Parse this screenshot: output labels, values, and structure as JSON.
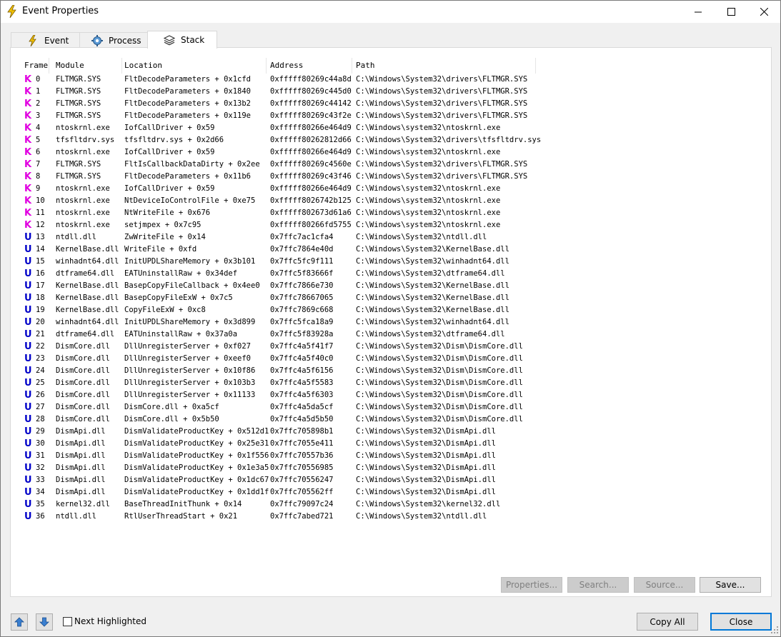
{
  "window": {
    "title": "Event Properties"
  },
  "tabs": [
    {
      "label": "Event",
      "icon": "lightning-icon",
      "active": false
    },
    {
      "label": "Process",
      "icon": "gear-icon",
      "active": false
    },
    {
      "label": "Stack",
      "icon": "layers-icon",
      "active": true
    }
  ],
  "columns": {
    "frame": "Frame",
    "module": "Module",
    "location": "Location",
    "address": "Address",
    "path": "Path"
  },
  "colors": {
    "kernel": "#e000e0",
    "user": "#0000c8",
    "accent": "#0078d7"
  },
  "frames": [
    {
      "type": "K",
      "frame": "0",
      "module": "FLTMGR.SYS",
      "location": "FltDecodeParameters + 0x1cfd",
      "address": "0xfffff80269c44a8d",
      "path": "C:\\Windows\\System32\\drivers\\FLTMGR.SYS"
    },
    {
      "type": "K",
      "frame": "1",
      "module": "FLTMGR.SYS",
      "location": "FltDecodeParameters + 0x1840",
      "address": "0xfffff80269c445d0",
      "path": "C:\\Windows\\System32\\drivers\\FLTMGR.SYS"
    },
    {
      "type": "K",
      "frame": "2",
      "module": "FLTMGR.SYS",
      "location": "FltDecodeParameters + 0x13b2",
      "address": "0xfffff80269c44142",
      "path": "C:\\Windows\\System32\\drivers\\FLTMGR.SYS"
    },
    {
      "type": "K",
      "frame": "3",
      "module": "FLTMGR.SYS",
      "location": "FltDecodeParameters + 0x119e",
      "address": "0xfffff80269c43f2e",
      "path": "C:\\Windows\\System32\\drivers\\FLTMGR.SYS"
    },
    {
      "type": "K",
      "frame": "4",
      "module": "ntoskrnl.exe",
      "location": "IofCallDriver + 0x59",
      "address": "0xfffff80266e464d9",
      "path": "C:\\Windows\\system32\\ntoskrnl.exe"
    },
    {
      "type": "K",
      "frame": "5",
      "module": "tfsfltdrv.sys",
      "location": "tfsfltdrv.sys + 0x2d66",
      "address": "0xfffff80262812d66",
      "path": "C:\\Windows\\System32\\drivers\\tfsfltdrv.sys"
    },
    {
      "type": "K",
      "frame": "6",
      "module": "ntoskrnl.exe",
      "location": "IofCallDriver + 0x59",
      "address": "0xfffff80266e464d9",
      "path": "C:\\Windows\\system32\\ntoskrnl.exe"
    },
    {
      "type": "K",
      "frame": "7",
      "module": "FLTMGR.SYS",
      "location": "FltIsCallbackDataDirty + 0x2ee",
      "address": "0xfffff80269c4560e",
      "path": "C:\\Windows\\System32\\drivers\\FLTMGR.SYS"
    },
    {
      "type": "K",
      "frame": "8",
      "module": "FLTMGR.SYS",
      "location": "FltDecodeParameters + 0x11b6",
      "address": "0xfffff80269c43f46",
      "path": "C:\\Windows\\System32\\drivers\\FLTMGR.SYS"
    },
    {
      "type": "K",
      "frame": "9",
      "module": "ntoskrnl.exe",
      "location": "IofCallDriver + 0x59",
      "address": "0xfffff80266e464d9",
      "path": "C:\\Windows\\system32\\ntoskrnl.exe"
    },
    {
      "type": "K",
      "frame": "10",
      "module": "ntoskrnl.exe",
      "location": "NtDeviceIoControlFile + 0xe75",
      "address": "0xfffff8026742b125",
      "path": "C:\\Windows\\system32\\ntoskrnl.exe"
    },
    {
      "type": "K",
      "frame": "11",
      "module": "ntoskrnl.exe",
      "location": "NtWriteFile + 0x676",
      "address": "0xfffff802673d61a6",
      "path": "C:\\Windows\\system32\\ntoskrnl.exe"
    },
    {
      "type": "K",
      "frame": "12",
      "module": "ntoskrnl.exe",
      "location": "setjmpex + 0x7c95",
      "address": "0xfffff80266fd5755",
      "path": "C:\\Windows\\system32\\ntoskrnl.exe"
    },
    {
      "type": "U",
      "frame": "13",
      "module": "ntdll.dll",
      "location": "ZwWriteFile + 0x14",
      "address": "0x7ffc7ac1cfa4",
      "path": "C:\\Windows\\System32\\ntdll.dll"
    },
    {
      "type": "U",
      "frame": "14",
      "module": "KernelBase.dll",
      "location": "WriteFile + 0xfd",
      "address": "0x7ffc7864e40d",
      "path": "C:\\Windows\\System32\\KernelBase.dll"
    },
    {
      "type": "U",
      "frame": "15",
      "module": "winhadnt64.dll",
      "location": "InitUPDLShareMemory + 0x3b101",
      "address": "0x7ffc5fc9f111",
      "path": "C:\\Windows\\System32\\winhadnt64.dll"
    },
    {
      "type": "U",
      "frame": "16",
      "module": "dtframe64.dll",
      "location": "EATUninstallRaw + 0x34def",
      "address": "0x7ffc5f83666f",
      "path": "C:\\Windows\\System32\\dtframe64.dll"
    },
    {
      "type": "U",
      "frame": "17",
      "module": "KernelBase.dll",
      "location": "BasepCopyFileCallback + 0x4ee0",
      "address": "0x7ffc7866e730",
      "path": "C:\\Windows\\System32\\KernelBase.dll"
    },
    {
      "type": "U",
      "frame": "18",
      "module": "KernelBase.dll",
      "location": "BasepCopyFileExW + 0x7c5",
      "address": "0x7ffc78667065",
      "path": "C:\\Windows\\System32\\KernelBase.dll"
    },
    {
      "type": "U",
      "frame": "19",
      "module": "KernelBase.dll",
      "location": "CopyFileExW + 0xc8",
      "address": "0x7ffc7869c668",
      "path": "C:\\Windows\\System32\\KernelBase.dll"
    },
    {
      "type": "U",
      "frame": "20",
      "module": "winhadnt64.dll",
      "location": "InitUPDLShareMemory + 0x3d899",
      "address": "0x7ffc5fca18a9",
      "path": "C:\\Windows\\System32\\winhadnt64.dll"
    },
    {
      "type": "U",
      "frame": "21",
      "module": "dtframe64.dll",
      "location": "EATUninstallRaw + 0x37a0a",
      "address": "0x7ffc5f83928a",
      "path": "C:\\Windows\\System32\\dtframe64.dll"
    },
    {
      "type": "U",
      "frame": "22",
      "module": "DismCore.dll",
      "location": "DllUnregisterServer + 0xf027",
      "address": "0x7ffc4a5f41f7",
      "path": "C:\\Windows\\System32\\Dism\\DismCore.dll"
    },
    {
      "type": "U",
      "frame": "23",
      "module": "DismCore.dll",
      "location": "DllUnregisterServer + 0xeef0",
      "address": "0x7ffc4a5f40c0",
      "path": "C:\\Windows\\System32\\Dism\\DismCore.dll"
    },
    {
      "type": "U",
      "frame": "24",
      "module": "DismCore.dll",
      "location": "DllUnregisterServer + 0x10f86",
      "address": "0x7ffc4a5f6156",
      "path": "C:\\Windows\\System32\\Dism\\DismCore.dll"
    },
    {
      "type": "U",
      "frame": "25",
      "module": "DismCore.dll",
      "location": "DllUnregisterServer + 0x103b3",
      "address": "0x7ffc4a5f5583",
      "path": "C:\\Windows\\System32\\Dism\\DismCore.dll"
    },
    {
      "type": "U",
      "frame": "26",
      "module": "DismCore.dll",
      "location": "DllUnregisterServer + 0x11133",
      "address": "0x7ffc4a5f6303",
      "path": "C:\\Windows\\System32\\Dism\\DismCore.dll"
    },
    {
      "type": "U",
      "frame": "27",
      "module": "DismCore.dll",
      "location": "DismCore.dll + 0xa5cf",
      "address": "0x7ffc4a5da5cf",
      "path": "C:\\Windows\\System32\\Dism\\DismCore.dll"
    },
    {
      "type": "U",
      "frame": "28",
      "module": "DismCore.dll",
      "location": "DismCore.dll + 0x5b50",
      "address": "0x7ffc4a5d5b50",
      "path": "C:\\Windows\\System32\\Dism\\DismCore.dll"
    },
    {
      "type": "U",
      "frame": "29",
      "module": "DismApi.dll",
      "location": "DismValidateProductKey + 0x512d1",
      "address": "0x7ffc705898b1",
      "path": "C:\\Windows\\System32\\DismApi.dll"
    },
    {
      "type": "U",
      "frame": "30",
      "module": "DismApi.dll",
      "location": "DismValidateProductKey + 0x25e31",
      "address": "0x7ffc7055e411",
      "path": "C:\\Windows\\System32\\DismApi.dll"
    },
    {
      "type": "U",
      "frame": "31",
      "module": "DismApi.dll",
      "location": "DismValidateProductKey + 0x1f556",
      "address": "0x7ffc70557b36",
      "path": "C:\\Windows\\System32\\DismApi.dll"
    },
    {
      "type": "U",
      "frame": "32",
      "module": "DismApi.dll",
      "location": "DismValidateProductKey + 0x1e3a5",
      "address": "0x7ffc70556985",
      "path": "C:\\Windows\\System32\\DismApi.dll"
    },
    {
      "type": "U",
      "frame": "33",
      "module": "DismApi.dll",
      "location": "DismValidateProductKey + 0x1dc67",
      "address": "0x7ffc70556247",
      "path": "C:\\Windows\\System32\\DismApi.dll"
    },
    {
      "type": "U",
      "frame": "34",
      "module": "DismApi.dll",
      "location": "DismValidateProductKey + 0x1dd1f",
      "address": "0x7ffc705562ff",
      "path": "C:\\Windows\\System32\\DismApi.dll"
    },
    {
      "type": "U",
      "frame": "35",
      "module": "kernel32.dll",
      "location": "BaseThreadInitThunk + 0x14",
      "address": "0x7ffc79097c24",
      "path": "C:\\Windows\\System32\\kernel32.dll"
    },
    {
      "type": "U",
      "frame": "36",
      "module": "ntdll.dll",
      "location": "RtlUserThreadStart + 0x21",
      "address": "0x7ffc7abed721",
      "path": "C:\\Windows\\System32\\ntdll.dll"
    }
  ],
  "panel_buttons": {
    "properties": "Properties...",
    "search": "Search...",
    "source": "Source...",
    "save": "Save..."
  },
  "footer": {
    "up_icon": "arrow-up-icon",
    "down_icon": "arrow-down-icon",
    "next_highlighted": "Next Highlighted",
    "next_highlighted_checked": false,
    "copy_all": "Copy All",
    "close": "Close"
  }
}
